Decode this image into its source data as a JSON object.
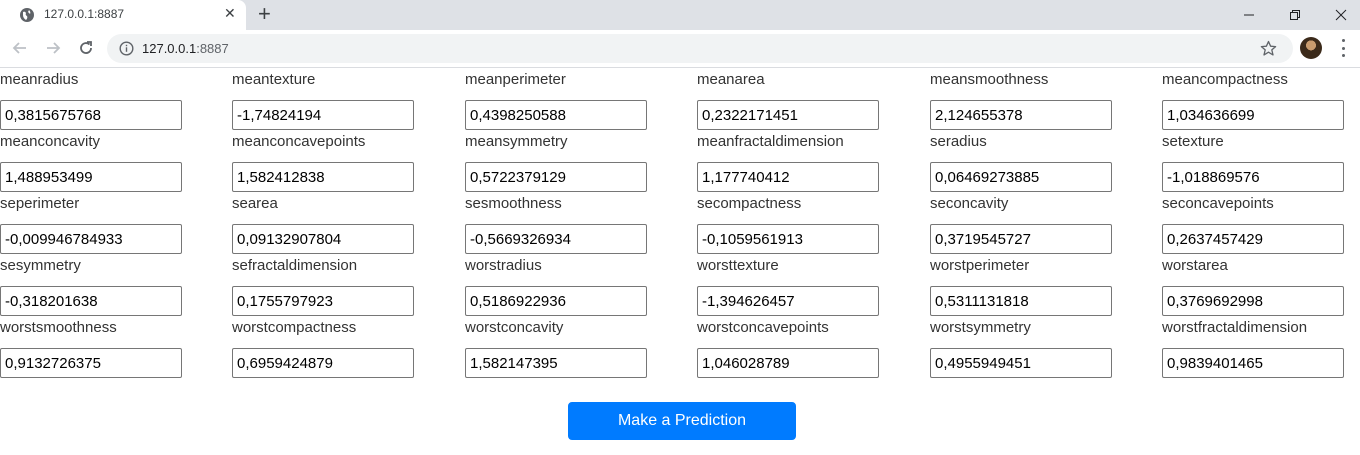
{
  "browser": {
    "tab_title": "127.0.0.1:8887",
    "new_tab_label": "+",
    "url_host": "127.0.0.1",
    "url_port": ":8887"
  },
  "form": {
    "fields": [
      {
        "label": "meanradius",
        "value": "0,3815675768"
      },
      {
        "label": "meantexture",
        "value": "-1,74824194"
      },
      {
        "label": "meanperimeter",
        "value": "0,4398250588"
      },
      {
        "label": "meanarea",
        "value": "0,2322171451"
      },
      {
        "label": "meansmoothness",
        "value": "2,124655378"
      },
      {
        "label": "meancompactness",
        "value": "1,034636699"
      },
      {
        "label": "meanconcavity",
        "value": "1,488953499"
      },
      {
        "label": "meanconcavepoints",
        "value": "1,582412838"
      },
      {
        "label": "meansymmetry",
        "value": "0,5722379129"
      },
      {
        "label": "meanfractaldimension",
        "value": "1,177740412"
      },
      {
        "label": "seradius",
        "value": "0,06469273885"
      },
      {
        "label": "setexture",
        "value": "-1,018869576"
      },
      {
        "label": "seperimeter",
        "value": "-0,009946784933"
      },
      {
        "label": "searea",
        "value": "0,09132907804"
      },
      {
        "label": "sesmoothness",
        "value": "-0,5669326934"
      },
      {
        "label": "secompactness",
        "value": "-0,1059561913"
      },
      {
        "label": "seconcavity",
        "value": "0,3719545727"
      },
      {
        "label": "seconcavepoints",
        "value": "0,2637457429"
      },
      {
        "label": "sesymmetry",
        "value": "-0,318201638"
      },
      {
        "label": "sefractaldimension",
        "value": "0,1755797923"
      },
      {
        "label": "worstradius",
        "value": "0,5186922936"
      },
      {
        "label": "worsttexture",
        "value": "-1,394626457"
      },
      {
        "label": "worstperimeter",
        "value": "0,5311131818"
      },
      {
        "label": "worstarea",
        "value": "0,3769692998"
      },
      {
        "label": "worstsmoothness",
        "value": "0,9132726375"
      },
      {
        "label": "worstcompactness",
        "value": "0,6959424879"
      },
      {
        "label": "worstconcavity",
        "value": "1,582147395"
      },
      {
        "label": "worstconcavepoints",
        "value": "1,046028789"
      },
      {
        "label": "worstsymmetry",
        "value": "0,4955949451"
      },
      {
        "label": "worstfractaldimension",
        "value": "0,9839401465"
      }
    ],
    "submit_label": "Make a Prediction"
  },
  "colors": {
    "button_bg": "#007bff",
    "tabbar_bg": "#dee1e6",
    "omnibox_bg": "#f1f3f4"
  }
}
